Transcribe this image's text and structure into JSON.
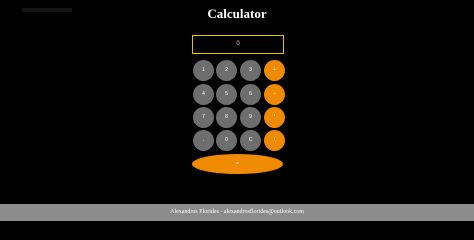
{
  "app": {
    "title": "Calculator"
  },
  "display": {
    "value": "0"
  },
  "keys": {
    "row1": [
      "1",
      "2",
      "3",
      "+"
    ],
    "row2": [
      "4",
      "5",
      "6",
      "-"
    ],
    "row3": [
      "7",
      "8",
      "9",
      "*"
    ],
    "row4": [
      ".",
      "0",
      "C",
      "/"
    ],
    "equals": "="
  },
  "footer": {
    "text": "Alexandros Florides - alexandrosflorides@outlook.com"
  },
  "colors": {
    "background": "#000000",
    "number_key": "#6e6e6e",
    "operator_key": "#f08a00",
    "display_border": "#e6c200",
    "footer_bar": "#8c8c8c"
  }
}
